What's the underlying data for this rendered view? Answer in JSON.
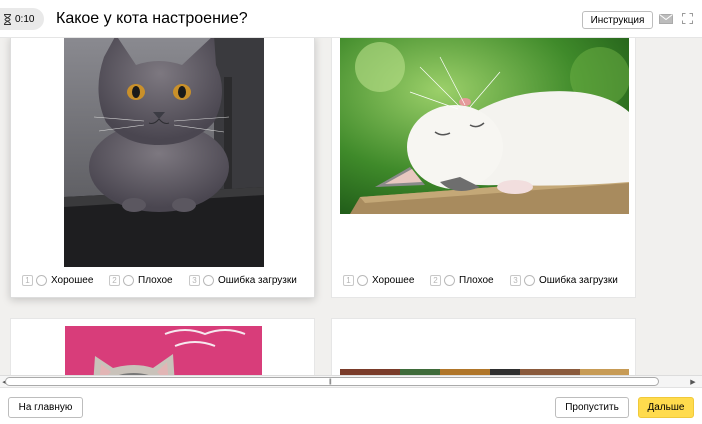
{
  "header": {
    "timer": "0:10",
    "title": "Какое у кота настроение?",
    "instruction_label": "Инструкция"
  },
  "cards": [
    {
      "photo": "grey British shorthair cat on a black chair",
      "options": [
        {
          "num": "1",
          "label": "Хорошее"
        },
        {
          "num": "2",
          "label": "Плохое"
        },
        {
          "num": "3",
          "label": "Ошибка загрузки"
        }
      ]
    },
    {
      "photo": "white cat sleeping on its back on a wooden plank",
      "options": [
        {
          "num": "1",
          "label": "Хорошее"
        },
        {
          "num": "2",
          "label": "Плохое"
        },
        {
          "num": "3",
          "label": "Ошибка загрузки"
        }
      ]
    },
    {
      "photo": "cat peeking up in front of a pink wall"
    },
    {
      "photo": "colorful photo, partially visible"
    }
  ],
  "footer": {
    "home_label": "На главную",
    "skip_label": "Пропустить",
    "next_label": "Дальше"
  },
  "colors": {
    "accent_button": "#ffdb4d",
    "content_background": "#f1f0ee"
  },
  "icons": [
    "hourglass-icon",
    "mail-icon",
    "fullscreen-icon",
    "scroll-left-icon",
    "scroll-right-icon"
  ]
}
